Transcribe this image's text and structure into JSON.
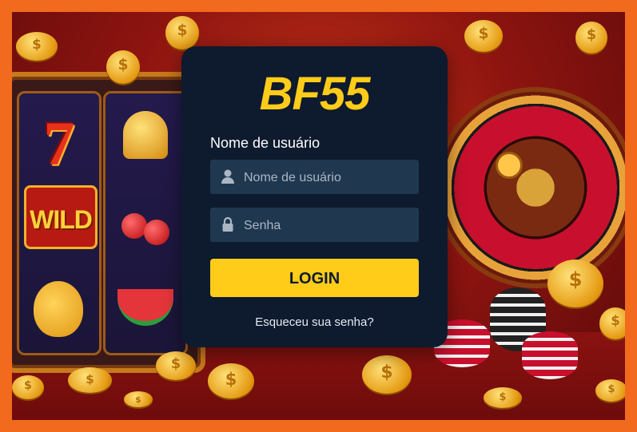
{
  "brand": {
    "logo_text": "BF55",
    "accent": "#ffcc1a"
  },
  "login": {
    "username_label": "Nome de usuário",
    "username_placeholder": "Nome de usuário",
    "password_placeholder": "Senha",
    "login_button": "LOGIN",
    "forgot_link": "Esqueceu sua senha?"
  },
  "background": {
    "slot_symbols": [
      "7",
      "WILD",
      "bell",
      "cherries",
      "pear",
      "watermelon"
    ],
    "wild_text": "WILD",
    "icons": [
      "user-icon",
      "lock-icon",
      "coin-icon",
      "roulette-wheel",
      "casino-chip-stack"
    ]
  },
  "colors": {
    "frame": "#f26a1e",
    "card_bg": "#0e1a2e",
    "field_bg": "#1f3850"
  }
}
